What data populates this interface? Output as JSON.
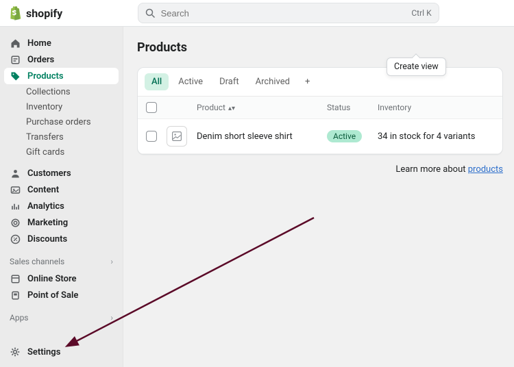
{
  "brand": "shopify",
  "search": {
    "placeholder": "Search",
    "value": "",
    "shortcut": "Ctrl K"
  },
  "nav": {
    "home": "Home",
    "orders": "Orders",
    "products": "Products",
    "products_children": [
      "Collections",
      "Inventory",
      "Purchase orders",
      "Transfers",
      "Gift cards"
    ],
    "customers": "Customers",
    "content": "Content",
    "analytics": "Analytics",
    "marketing": "Marketing",
    "discounts": "Discounts",
    "sales_channels_label": "Sales channels",
    "online_store": "Online Store",
    "point_of_sale": "Point of Sale",
    "apps_label": "Apps",
    "settings": "Settings"
  },
  "page": {
    "title": "Products"
  },
  "tooltip": "Create view",
  "tabs": [
    "All",
    "Active",
    "Draft",
    "Archived"
  ],
  "table": {
    "headers": {
      "product": "Product",
      "status": "Status",
      "inventory": "Inventory"
    },
    "rows": [
      {
        "name": "Denim short sleeve shirt",
        "status": "Active",
        "inventory": "34 in stock for 4 variants"
      }
    ]
  },
  "learn_more": {
    "prefix": "Learn more about ",
    "link": "products"
  }
}
